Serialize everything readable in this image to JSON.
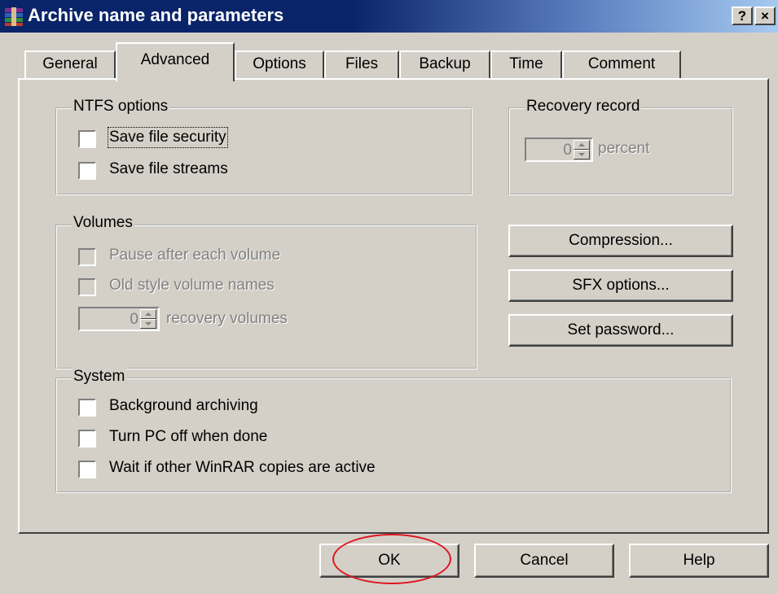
{
  "window": {
    "title": "Archive name and parameters",
    "help_button": "?",
    "close_button": "×"
  },
  "tabs": [
    "General",
    "Advanced",
    "Options",
    "Files",
    "Backup",
    "Time",
    "Comment"
  ],
  "active_tab": "Advanced",
  "ntfs": {
    "label": "NTFS options",
    "save_security": "Save file security",
    "save_streams": "Save file streams"
  },
  "recovery": {
    "label": "Recovery record",
    "value": "0",
    "unit": "percent"
  },
  "volumes": {
    "label": "Volumes",
    "pause": "Pause after each volume",
    "old_style": "Old style volume names",
    "recovery_value": "0",
    "recovery_label": "recovery volumes"
  },
  "side_buttons": {
    "compression": "Compression...",
    "sfx": "SFX options...",
    "password": "Set password..."
  },
  "system": {
    "label": "System",
    "background": "Background archiving",
    "turn_off": "Turn PC off when done",
    "wait": "Wait if other WinRAR copies are active"
  },
  "footer": {
    "ok": "OK",
    "cancel": "Cancel",
    "help": "Help"
  },
  "colors": {
    "title_bar": "#0a246a",
    "annotation_circle": "#e0141e"
  }
}
